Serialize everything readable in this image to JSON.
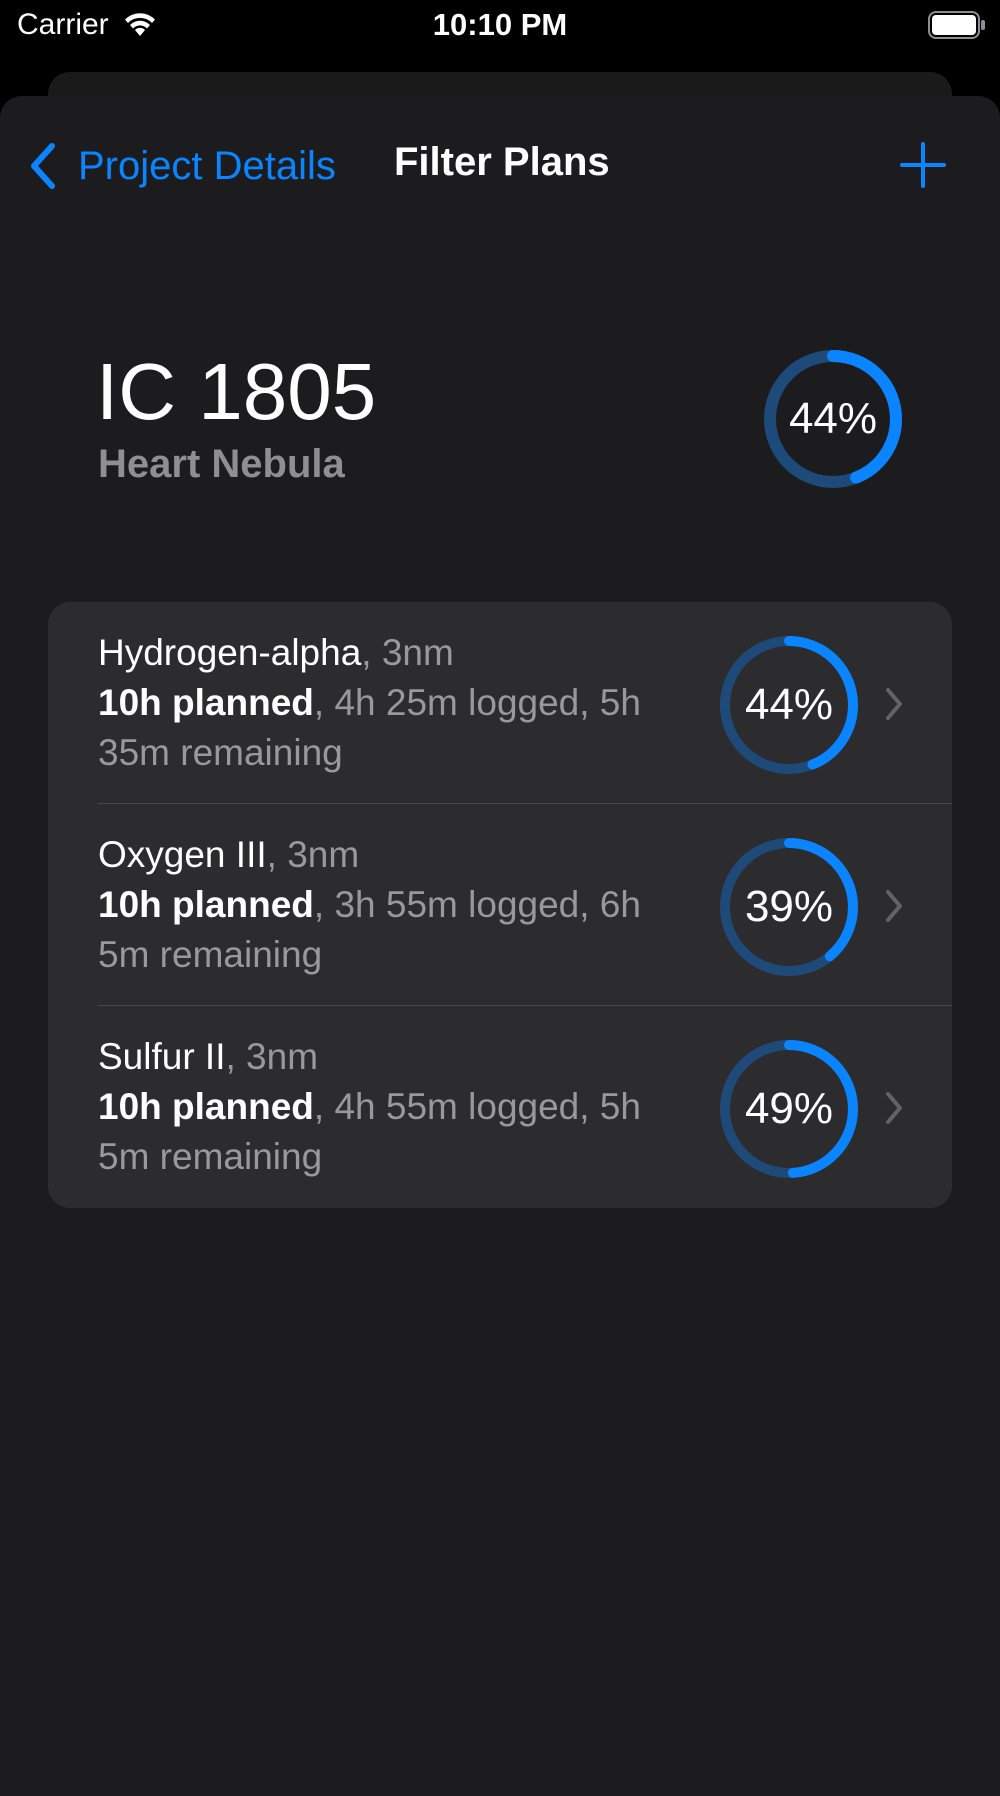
{
  "status_bar": {
    "carrier": "Carrier",
    "time": "10:10 PM"
  },
  "nav": {
    "back_label": "Project Details",
    "title": "Filter Plans",
    "add_icon": "plus-icon"
  },
  "target": {
    "id": "IC 1805",
    "name": "Heart Nebula",
    "progress": 0.44,
    "progress_label": "44%"
  },
  "plans": [
    {
      "filter": "Hydrogen-alpha",
      "bandwidth": ", 3nm",
      "planned": "10h planned",
      "detail_line1": ", 4h 25m logged, 5h",
      "detail_line2": "35m remaining",
      "progress": 0.44,
      "progress_label": "44%"
    },
    {
      "filter": "Oxygen III",
      "bandwidth": ", 3nm",
      "planned": "10h planned",
      "detail_line1": ", 3h 55m logged, 6h",
      "detail_line2": "5m remaining",
      "progress": 0.39,
      "progress_label": "39%"
    },
    {
      "filter": "Sulfur II",
      "bandwidth": ", 3nm",
      "planned": "10h planned",
      "detail_line1": ", 4h 55m logged, 5h",
      "detail_line2": "5m remaining",
      "progress": 0.49,
      "progress_label": "49%"
    }
  ],
  "colors": {
    "accent": "#0a84ff",
    "ring_track": "#1e4a7a",
    "background": "#1c1c1e",
    "card": "#2c2c2e",
    "secondary_text": "#98989d"
  }
}
